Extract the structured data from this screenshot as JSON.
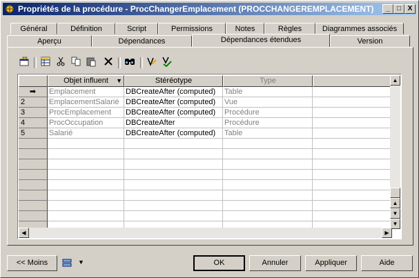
{
  "window": {
    "title": "Propriétés de la procédure - ProcChangerEmplacement (PROCCHANGEREMPLACEMENT)",
    "minimize": "_",
    "maximize": "□",
    "close": "X"
  },
  "tabs_row1": [
    {
      "label": "Général"
    },
    {
      "label": "Définition"
    },
    {
      "label": "Script"
    },
    {
      "label": "Permissions"
    },
    {
      "label": "Notes"
    },
    {
      "label": "Règles"
    },
    {
      "label": "Diagrammes associés"
    }
  ],
  "tabs_row2": [
    {
      "label": "Aperçu"
    },
    {
      "label": "Dépendances"
    },
    {
      "label": "Dépendances étendues",
      "active": true
    },
    {
      "label": "Version"
    }
  ],
  "toolbar": {
    "icons": [
      "properties-icon",
      "add-rows-icon",
      "cut-icon",
      "copy-icon",
      "paste-icon",
      "delete-icon",
      "find-icon",
      "customize-columns-icon",
      "filter-icon"
    ]
  },
  "grid": {
    "columns": [
      "Objet influent",
      "Stéréotype",
      "Type"
    ],
    "rows": [
      {
        "num": "➡",
        "object": "Emplacement",
        "stereotype": "DBCreateAfter (computed)",
        "type": "Table"
      },
      {
        "num": "2",
        "object": "EmplacementSalarié",
        "stereotype": "DBCreateAfter (computed)",
        "type": "Vue"
      },
      {
        "num": "3",
        "object": "ProcEmplacement",
        "stereotype": "DBCreateAfter (computed)",
        "type": "Procédure"
      },
      {
        "num": "4",
        "object": "ProcOccupation",
        "stereotype": "DBCreateAfter",
        "type": "Procédure"
      },
      {
        "num": "5",
        "object": "Salarié",
        "stereotype": "DBCreateAfter (computed)",
        "type": "Table"
      }
    ]
  },
  "buttons": {
    "less": "<< Moins",
    "ok": "OK",
    "cancel": "Annuler",
    "apply": "Appliquer",
    "help": "Aide"
  }
}
